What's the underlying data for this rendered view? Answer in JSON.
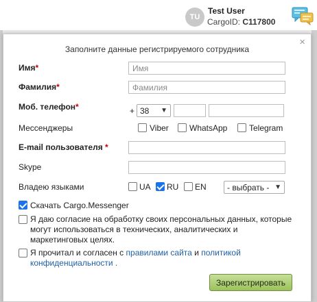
{
  "header": {
    "avatar_initials": "TU",
    "user_name": "Test User",
    "cargo_id_label": "CargoID:",
    "cargo_id_value": "C117800",
    "chat_icon": "chat-bubbles-icon"
  },
  "modal": {
    "title": "Заполните данные регистрируемого сотрудника",
    "close_glyph": "×",
    "required_mark": "*",
    "name": {
      "label": "Имя",
      "placeholder": "Имя"
    },
    "surname": {
      "label": "Фамилия",
      "placeholder": "Фамилия"
    },
    "phone": {
      "label": "Моб. телефон",
      "prefix": "+",
      "country_code": "38",
      "value_1": "",
      "value_2": ""
    },
    "messengers": {
      "label": "Мессенджеры",
      "options": [
        {
          "label": "Viber",
          "checked": false
        },
        {
          "label": "WhatsApp",
          "checked": false
        },
        {
          "label": "Telegram",
          "checked": false
        }
      ]
    },
    "email": {
      "label": "E-mail пользователя",
      "value": ""
    },
    "skype": {
      "label": "Skype",
      "value": ""
    },
    "languages": {
      "label": "Владею языками",
      "options": [
        {
          "label": "UA",
          "checked": false
        },
        {
          "label": "RU",
          "checked": true
        },
        {
          "label": "EN",
          "checked": false
        }
      ],
      "more_select": "- выбрать -"
    },
    "download_messenger": {
      "label": "Скачать Cargo.Messenger",
      "checked": true
    },
    "consent": {
      "checked": false,
      "text": "Я даю согласие на обработку своих персональных данных, которые могут использоваться в технических, аналитических и маркетинговых целях."
    },
    "terms": {
      "checked": false,
      "text_before": "Я прочитал и согласен с",
      "rules_link": "правилами сайта",
      "and": "и",
      "policy_link": "политикой конфиденциальности",
      "end": "."
    },
    "submit_label": "Зарегистрировать"
  },
  "colors": {
    "accent_blue": "#1a73e8",
    "link": "#1f5fa8",
    "required": "#c30000",
    "button_green": "#9cc15c"
  }
}
